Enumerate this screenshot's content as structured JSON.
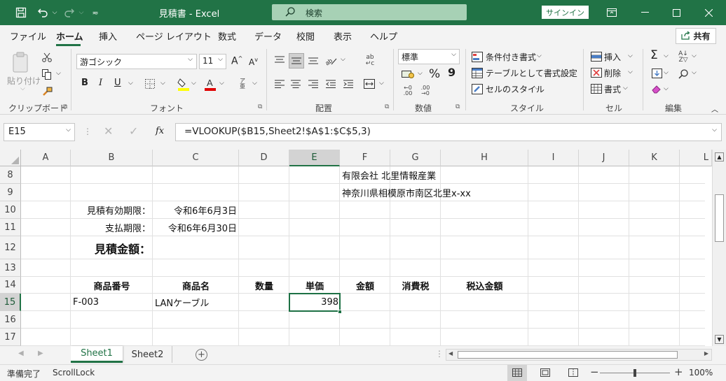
{
  "window": {
    "title": "見積書 - Excel",
    "search_label": "検索",
    "signin_label": "サインイン"
  },
  "ribbon_tabs": [
    "ファイル",
    "ホーム",
    "挿入",
    "ページ レイアウト",
    "数式",
    "データ",
    "校閲",
    "表示",
    "ヘルプ"
  ],
  "share_label": "共有",
  "clipboard": {
    "paste_label": "貼り付け",
    "group_label": "クリップボード"
  },
  "font": {
    "name": "游ゴシック",
    "size": "11",
    "group_label": "フォント"
  },
  "alignment": {
    "group_label": "配置"
  },
  "number": {
    "format": "標準",
    "percent": "%",
    "comma": "9",
    "group_label": "数値"
  },
  "styles": {
    "conditional": "条件付き書式",
    "table": "テーブルとして書式設定",
    "cell": "セルのスタイル",
    "group_label": "スタイル"
  },
  "cells": {
    "insert": "挿入",
    "delete": "削除",
    "format": "書式",
    "group_label": "セル"
  },
  "editing": {
    "group_label": "編集"
  },
  "formula_bar": {
    "name_box": "E15",
    "formula": "=VLOOKUP($B15,Sheet2!$A$1:$C$5,3)",
    "fx": "fx"
  },
  "columns": [
    "A",
    "B",
    "C",
    "D",
    "E",
    "F",
    "G",
    "H",
    "I",
    "J",
    "K",
    "L"
  ],
  "rows": [
    "8",
    "9",
    "10",
    "11",
    "12",
    "13",
    "14",
    "15",
    "16",
    "17"
  ],
  "cells_data": {
    "F8": "有限会社 北里情報産業",
    "F9": "神奈川県相模原市南区北里x-xx",
    "B10": "見積有効期限：",
    "C10": "令和6年6月3日",
    "B11": "支払期限：",
    "C11": "令和6年6月30日",
    "B12": "見積金額：",
    "B14": "商品番号",
    "C14": "商品名",
    "D14": "数量",
    "E14": "単価",
    "F14": "金額",
    "G14": "消費税",
    "H14": "税込金額",
    "B15": "F-003",
    "C15": "LANケーブル",
    "E15": "398"
  },
  "sheet_tabs": [
    "Sheet1",
    "Sheet2"
  ],
  "status": {
    "ready": "準備完了",
    "scroll_lock": "ScrollLock",
    "zoom": "100%"
  },
  "colors": {
    "accent": "#217346",
    "selection": "#1e7145",
    "search_box": "#a7d1b5"
  }
}
